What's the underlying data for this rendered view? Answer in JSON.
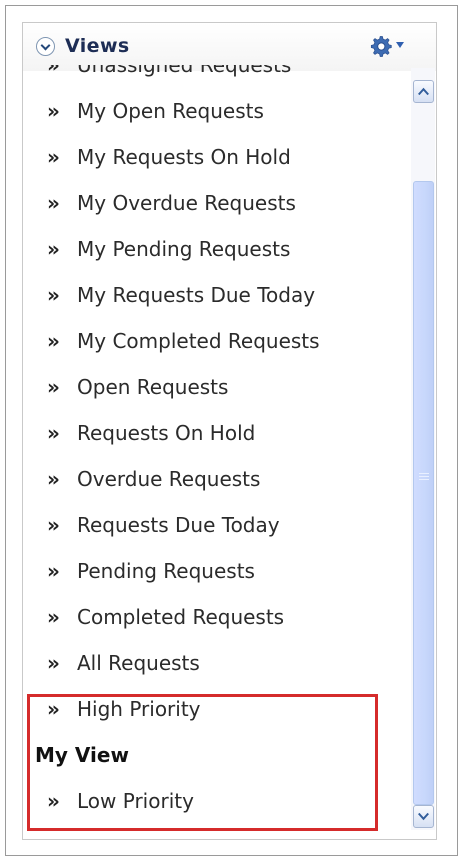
{
  "panel": {
    "title": "Views",
    "icons": {
      "collapse": "circle-chevron-down-icon",
      "settings": "gear-icon",
      "dropdown": "caret-down-icon"
    },
    "items": [
      "Unassigned Requests",
      "My Open Requests",
      "My Requests On Hold",
      "My Overdue Requests",
      "My Pending Requests",
      "My Requests Due Today",
      "My Completed Requests",
      "Open Requests",
      "Requests On Hold",
      "Overdue Requests",
      "Requests Due Today",
      "Pending Requests",
      "Completed Requests",
      "All Requests",
      "High Priority"
    ],
    "section_heading": "My View",
    "section_items": [
      "Low Priority"
    ],
    "bullet": "»"
  },
  "colors": {
    "title": "#1d2d55",
    "highlight_border": "#d52b2b",
    "scroll_thumb": "#c7d7fb"
  }
}
